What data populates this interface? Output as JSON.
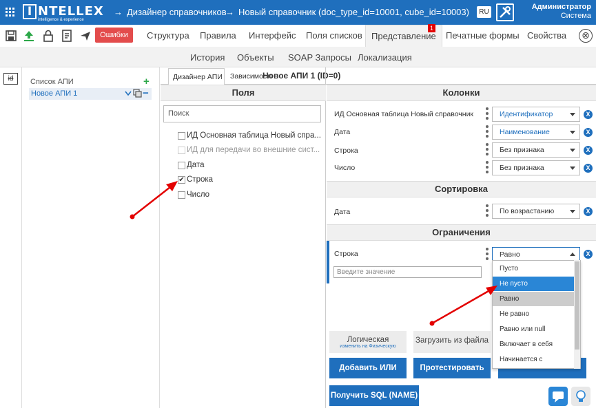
{
  "topbar": {
    "logo_letter": "I",
    "logo_word": "NTELLEX",
    "logo_sub": "intelligence & experience",
    "crumb1": "Дизайнер справочников",
    "crumb2": "Новый справочник (doc_type_id=10001, cube_id=10003)",
    "lang": "RU",
    "user_name": "Администратор",
    "user_role": "Система"
  },
  "toolbar": {
    "errors_label": "Ошибки",
    "tabs": [
      "Структура",
      "Правила",
      "Интерфейс",
      "Поля списков",
      "Представление",
      "Печатные формы",
      "Свойства"
    ],
    "badge": "1",
    "close": "⊗"
  },
  "subtabs": [
    "История",
    "Объекты",
    "SOAP Запросы",
    "Локализация"
  ],
  "tree": {
    "title": "Список АПИ",
    "item": "Новое АПИ 1"
  },
  "panel": {
    "tabs": [
      "Дизайнер АПИ",
      "Зависимости"
    ],
    "api_title": "Новое АПИ 1 (ID=0)"
  },
  "fields": {
    "header": "Поля",
    "search_placeholder": "Поиск",
    "items": [
      {
        "label": "ИД Основная таблица Новый спра...",
        "checked": false,
        "disabled": false
      },
      {
        "label": "ИД для передачи во внешние сист...",
        "checked": false,
        "disabled": true
      },
      {
        "label": "Дата",
        "checked": false,
        "disabled": false
      },
      {
        "label": "Строка",
        "checked": true,
        "disabled": false
      },
      {
        "label": "Число",
        "checked": false,
        "disabled": false
      }
    ]
  },
  "columns": {
    "header": "Колонки",
    "rows": [
      {
        "label": "ИД Основная таблица Новый справочник",
        "value": "Идентификатор"
      },
      {
        "label": "Дата",
        "value": "Наименование"
      },
      {
        "label": "Строка",
        "value": "Без признака"
      },
      {
        "label": "Число",
        "value": "Без признака"
      }
    ]
  },
  "sorting": {
    "header": "Сортировка",
    "label": "Дата",
    "value": "По возрастанию"
  },
  "constraints": {
    "header": "Ограничения",
    "label": "Строка",
    "value": "Равно",
    "input_placeholder": "Введите значение",
    "options": [
      "Пусто",
      "Не пусто",
      "Равно",
      "Не равно",
      "Равно или null",
      "Включает в себя",
      "Начинается с"
    ],
    "highlighted": "Не пусто",
    "selected": "Равно"
  },
  "buttons": {
    "logic_label": "Логическая",
    "logic_sub": "изменить на Физическую",
    "load_file": "Загрузить из файла",
    "add_or": "Добавить ИЛИ",
    "test": "Протестировать",
    "sql": "Получить SQL (NAME)"
  },
  "colors": {
    "primary": "#1f6fbd",
    "danger": "#e34c4c",
    "annotation": "#e30000"
  }
}
